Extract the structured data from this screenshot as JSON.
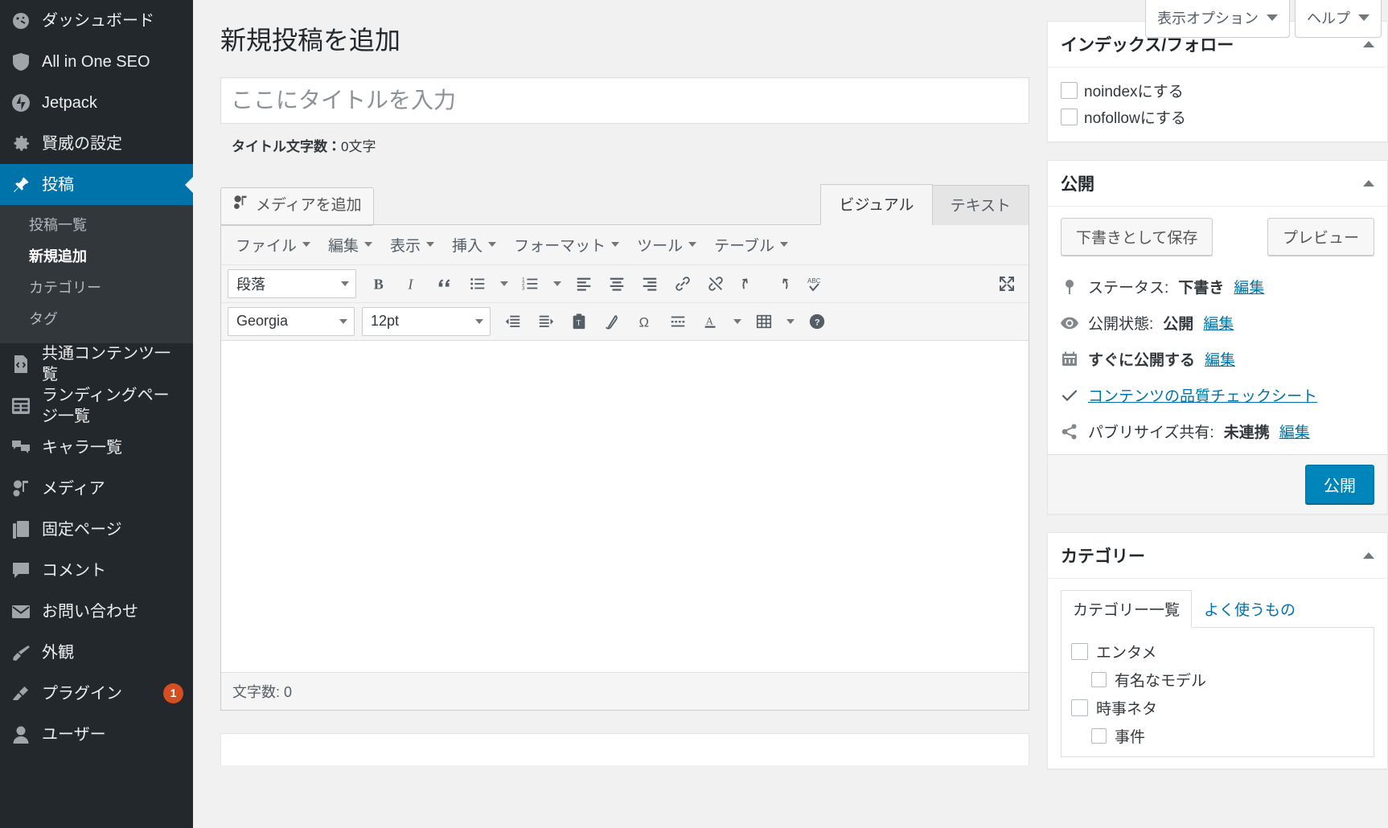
{
  "sidebar": {
    "items": [
      {
        "label": "ダッシュボード",
        "icon": "dashboard-icon"
      },
      {
        "label": "All in One SEO",
        "icon": "shield-icon"
      },
      {
        "label": "Jetpack",
        "icon": "jetpack-icon"
      },
      {
        "label": "賢威の設定",
        "icon": "gear-icon"
      },
      {
        "label": "投稿",
        "icon": "pin-icon",
        "current": true
      }
    ],
    "submenu": [
      {
        "label": "投稿一覧"
      },
      {
        "label": "新規追加",
        "active": true
      },
      {
        "label": "カテゴリー"
      },
      {
        "label": "タグ"
      }
    ],
    "items2": [
      {
        "label": "共通コンテンツ一覧",
        "icon": "code-file-icon"
      },
      {
        "label": "ランディングページ一覧",
        "icon": "layout-icon"
      },
      {
        "label": "キャラ一覧",
        "icon": "chat-bubbles-icon"
      },
      {
        "label": "メディア",
        "icon": "media-icon"
      },
      {
        "label": "固定ページ",
        "icon": "pages-icon"
      },
      {
        "label": "コメント",
        "icon": "comment-icon"
      },
      {
        "label": "お問い合わせ",
        "icon": "mail-icon"
      },
      {
        "label": "外観",
        "icon": "brush-icon"
      },
      {
        "label": "プラグイン",
        "icon": "plug-icon",
        "badge": "1"
      },
      {
        "label": "ユーザー",
        "icon": "user-icon"
      }
    ]
  },
  "screen_meta": {
    "display_options": "表示オプション",
    "help": "ヘルプ"
  },
  "page": {
    "title": "新規投稿を追加",
    "title_placeholder": "ここにタイトルを入力",
    "title_value": "",
    "title_count_label": "タイトル文字数：",
    "title_count_value": "0文字"
  },
  "editor": {
    "add_media": "メディアを追加",
    "tab_visual": "ビジュアル",
    "tab_text": "テキスト",
    "menubar": [
      "ファイル",
      "編集",
      "表示",
      "挿入",
      "フォーマット",
      "ツール",
      "テーブル"
    ],
    "format_select": "段落",
    "font_select": "Georgia",
    "size_select": "12pt",
    "toolbar_row1": [
      "bold-icon",
      "italic-icon",
      "blockquote-icon",
      "bullet-list-icon",
      "bullet-list-caret",
      "numbered-list-icon",
      "numbered-list-caret",
      "align-left-icon",
      "align-center-icon",
      "align-right-icon",
      "link-icon",
      "unlink-icon",
      "undo-icon",
      "redo-icon",
      "spellcheck-icon",
      "fullscreen-icon"
    ],
    "toolbar_row2": [
      "decrease-indent-icon",
      "increase-indent-icon",
      "paste-text-icon",
      "clear-formatting-icon",
      "special-character-icon",
      "read-more-icon",
      "text-color-icon",
      "text-color-caret",
      "table-icon",
      "table-caret",
      "help-icon"
    ],
    "status": "文字数: 0",
    "body_value": ""
  },
  "index_follow": {
    "title": "インデックス/フォロー",
    "options": [
      {
        "label": "noindexにする",
        "checked": false
      },
      {
        "label": "nofollowにする",
        "checked": false
      }
    ]
  },
  "publish": {
    "title": "公開",
    "save_draft": "下書きとして保存",
    "preview": "プレビュー",
    "rows": [
      {
        "icon": "pin-marker-icon",
        "prefix": "ステータス: ",
        "value": "下書き",
        "link": "編集"
      },
      {
        "icon": "eye-icon",
        "prefix": "公開状態: ",
        "value": "公開",
        "link": "編集"
      },
      {
        "icon": "calendar-icon",
        "prefix": "",
        "value": "すぐに公開する",
        "link": "編集"
      },
      {
        "icon": "check-icon",
        "prefix": "",
        "value": "",
        "link": "コンテンツの品質チェックシート"
      },
      {
        "icon": "share-icon",
        "prefix": "パブリサイズ共有: ",
        "value": "未連携",
        "link": "編集"
      }
    ],
    "publish_button": "公開"
  },
  "categories": {
    "title": "カテゴリー",
    "tab_all": "カテゴリー一覧",
    "tab_frequent": "よく使うもの",
    "items": [
      {
        "label": "エンタメ",
        "child": false,
        "checked": false
      },
      {
        "label": "有名なモデル",
        "child": true,
        "checked": false
      },
      {
        "label": "時事ネタ",
        "child": false,
        "checked": false
      },
      {
        "label": "事件",
        "child": true,
        "checked": false
      }
    ]
  },
  "colors": {
    "sidebar_bg": "#23282d",
    "submenu_bg": "#32373c",
    "accent": "#0073aa",
    "primary_button": "#0085ba",
    "badge": "#d54e21",
    "link": "#0073aa"
  }
}
